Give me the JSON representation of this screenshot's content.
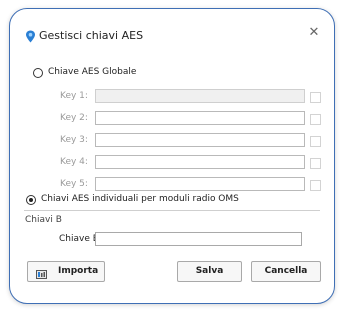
{
  "dialog": {
    "title": "Gestisci chiavi AES",
    "close_glyph": "✕",
    "icon": "location-pin-icon"
  },
  "global_option": {
    "label": "Chiave AES Globale",
    "selected": false,
    "keys": [
      {
        "label": "Key 1:",
        "value": "",
        "enabled": false,
        "checked": false
      },
      {
        "label": "Key 2:",
        "value": "",
        "enabled": true,
        "checked": false
      },
      {
        "label": "Key 3:",
        "value": "",
        "enabled": true,
        "checked": false
      },
      {
        "label": "Key 4:",
        "value": "",
        "enabled": true,
        "checked": false
      },
      {
        "label": "Key 5:",
        "value": "",
        "enabled": true,
        "checked": false
      }
    ]
  },
  "individual_option": {
    "label": "Chiavi AES individuali per moduli radio OMS",
    "selected": true
  },
  "chiavi_b": {
    "section_label": "Chiavi B",
    "field_label": "Chiave B:",
    "value": ""
  },
  "buttons": {
    "import_label": "Importa",
    "import_icon": "import-file-icon",
    "save_label": "Salva",
    "cancel_label": "Cancella"
  },
  "colors": {
    "border_accent": "#3f6fb5",
    "icon_accent": "#2a7fd4"
  }
}
